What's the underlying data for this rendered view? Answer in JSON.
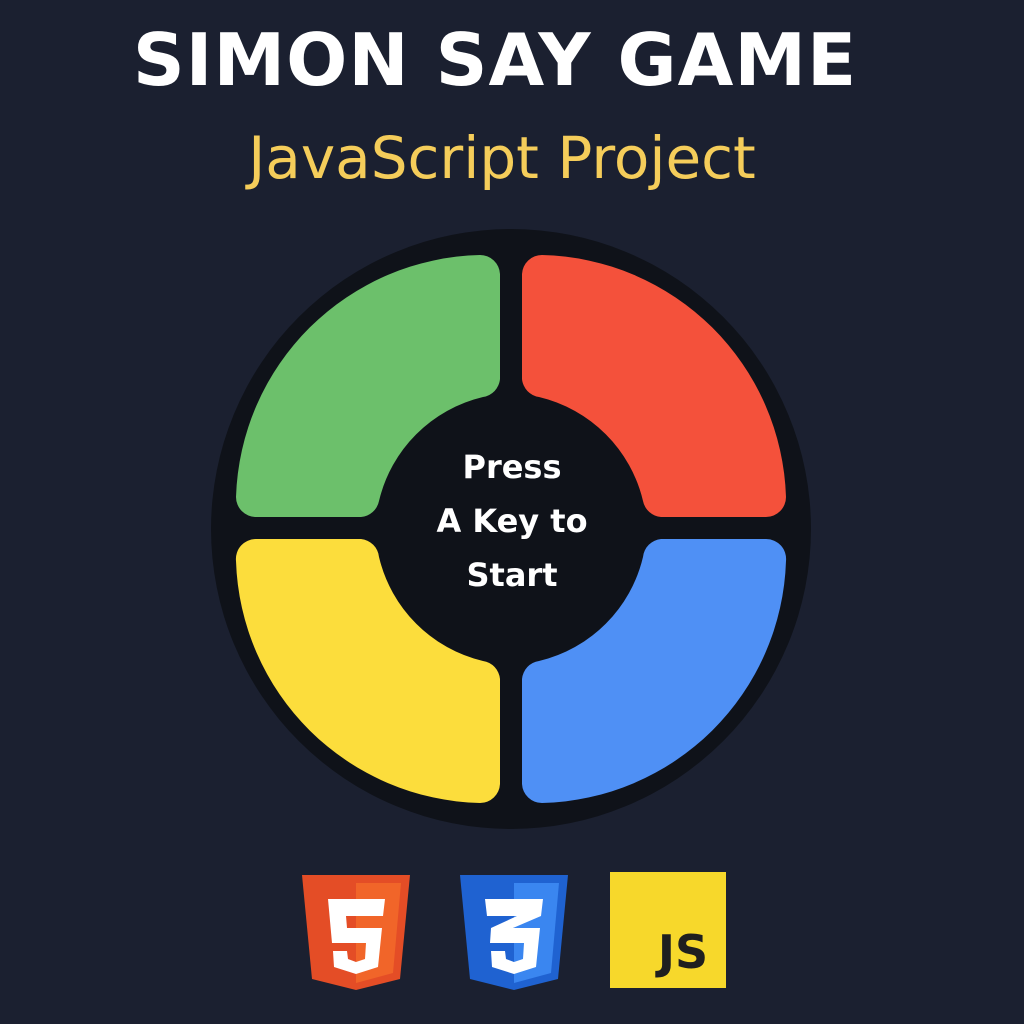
{
  "header": {
    "title": "SIMON SAY GAME",
    "subtitle": "JavaScript Project"
  },
  "game": {
    "pads": [
      {
        "name": "green",
        "color": "#6cc06b"
      },
      {
        "name": "red",
        "color": "#f4513b"
      },
      {
        "name": "yellow",
        "color": "#fcdd3c"
      },
      {
        "name": "blue",
        "color": "#4f90f5"
      }
    ],
    "board_color": "#0f1219",
    "center_text": {
      "line1": "Press",
      "line2": "A Key to",
      "line3": "Start"
    }
  },
  "logos": {
    "html5": {
      "icon": "html5-logo-icon",
      "glyph": "5",
      "color": "#e44d26",
      "shade": "#f16529"
    },
    "css3": {
      "icon": "css3-logo-icon",
      "glyph": "3",
      "color": "#1f62d1",
      "shade": "#3a86f0"
    },
    "js": {
      "icon": "js-logo-icon",
      "label": "JS",
      "color": "#f7d82b"
    }
  }
}
